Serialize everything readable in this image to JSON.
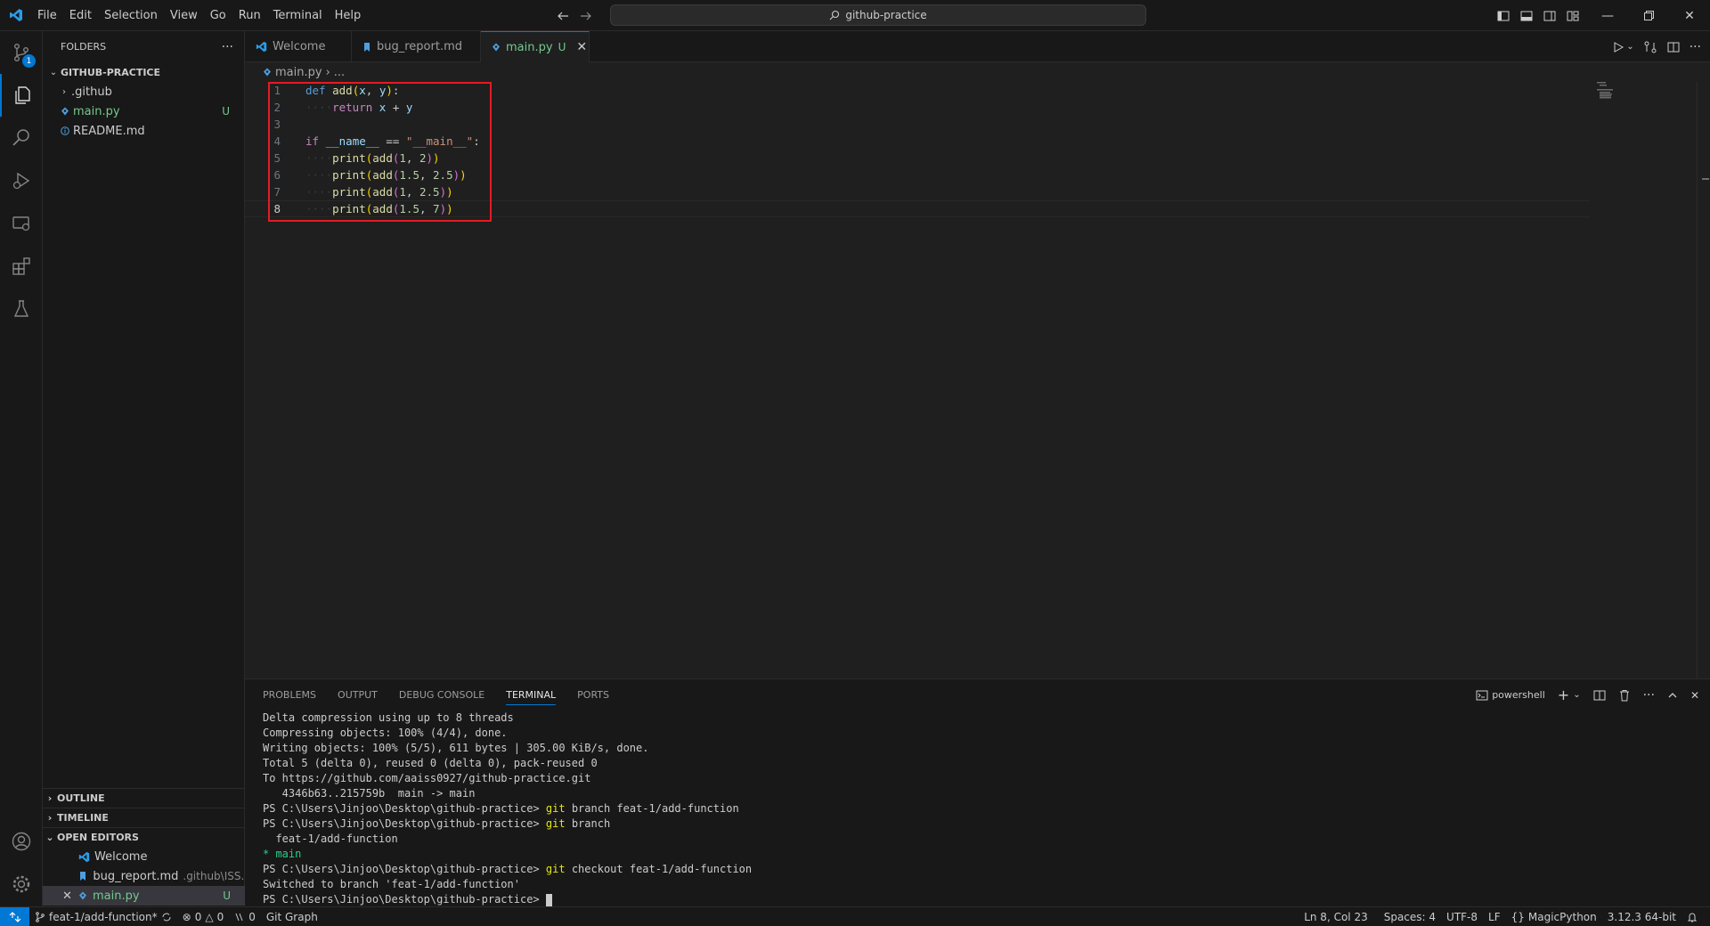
{
  "menu": [
    "File",
    "Edit",
    "Selection",
    "View",
    "Go",
    "Run",
    "Terminal",
    "Help"
  ],
  "command_center": "github-practice",
  "activity_badge": "1",
  "sidebar": {
    "header": "FOLDERS",
    "root": "GITHUB-PRACTICE",
    "items": [
      {
        "label": ".github",
        "type": "folder"
      },
      {
        "label": "main.py",
        "status": "U"
      },
      {
        "label": "README.md"
      }
    ],
    "outline": "OUTLINE",
    "timeline": "TIMELINE",
    "open_editors": "OPEN EDITORS",
    "open_editor_items": [
      {
        "label": "Welcome",
        "desc": ""
      },
      {
        "label": "bug_report.md",
        "desc": ".github\\ISS..."
      },
      {
        "label": "main.py",
        "status": "U"
      }
    ]
  },
  "tabs": [
    {
      "label": "Welcome"
    },
    {
      "label": "bug_report.md"
    },
    {
      "label": "main.py",
      "status": "U",
      "active": true
    }
  ],
  "breadcrumb": {
    "file": "main.py",
    "rest": "..."
  },
  "code": {
    "line_numbers": [
      "1",
      "2",
      "3",
      "4",
      "5",
      "6",
      "7",
      "8"
    ],
    "lines": [
      "def add(x, y):",
      "    return x + y",
      "",
      "if __name__ == \"__main__\":",
      "    print(add(1, 2))",
      "    print(add(1.5, 2.5))",
      "    print(add(1, 2.5))",
      "    print(add(1.5, 7))"
    ]
  },
  "panel": {
    "tabs": [
      "PROBLEMS",
      "OUTPUT",
      "DEBUG CONSOLE",
      "TERMINAL",
      "PORTS"
    ],
    "active_tab": "TERMINAL",
    "shell": "powershell",
    "terminal": {
      "l1": "Delta compression using up to 8 threads",
      "l2": "Compressing objects: 100% (4/4), done.",
      "l3": "Writing objects: 100% (5/5), 611 bytes | 305.00 KiB/s, done.",
      "l4": "Total 5 (delta 0), reused 0 (delta 0), pack-reused 0",
      "l5": "To https://github.com/aaiss0927/github-practice.git",
      "l6": "   4346b63..215759b  main -> main",
      "prompt": "PS C:\\Users\\Jinjoo\\Desktop\\github-practice>",
      "git": "git",
      "c1_args": "branch feat-1/add-function",
      "c2_args": "branch",
      "b1": "  feat-1/add-function",
      "b2": "* main",
      "c3_args": "checkout feat-1/add-function",
      "switched": "Switched to branch 'feat-1/add-function'"
    }
  },
  "status": {
    "branch": "feat-1/add-function*",
    "errors": "0",
    "warnings": "0",
    "ports": "0",
    "git_graph": "Git Graph",
    "position": "Ln 8, Col 23",
    "spaces": "Spaces: 4",
    "encoding": "UTF-8",
    "eol": "LF",
    "language": "MagicPython",
    "interpreter": "3.12.3 64-bit"
  },
  "colors": {
    "accent": "#0078d4",
    "untracked": "#73c991",
    "highlight": "#e51b23"
  }
}
